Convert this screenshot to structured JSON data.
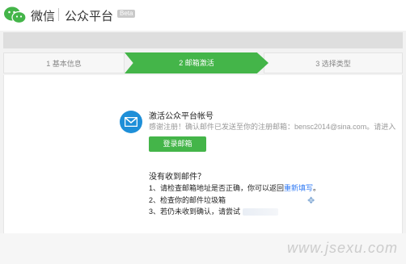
{
  "header": {
    "brand": "微信",
    "product": "公众平台",
    "badge": "Beta"
  },
  "steps": [
    {
      "label": "1 基本信息"
    },
    {
      "label": "2 邮箱激活"
    },
    {
      "label": "3 选择类型"
    }
  ],
  "activation": {
    "title": "激活公众平台帐号",
    "description": "感谢注册！确认邮件已发送至你的注册邮箱：bensc2014@sina.com。请进入",
    "login_button": "登录邮箱"
  },
  "help": {
    "title": "没有收到邮件？",
    "line1_prefix": "1、请检查邮箱地址是否正确，你可以返回",
    "line1_link": "重新填写",
    "line1_suffix": "。",
    "line2": "2、检查你的邮件垃圾箱",
    "line3": "3、若仍未收到确认，请尝试"
  },
  "watermark": "www.jsexu.com",
  "colors": {
    "accent": "#44b549",
    "mail_icon_bg": "#1e8fd8",
    "link": "#2d78f4"
  }
}
